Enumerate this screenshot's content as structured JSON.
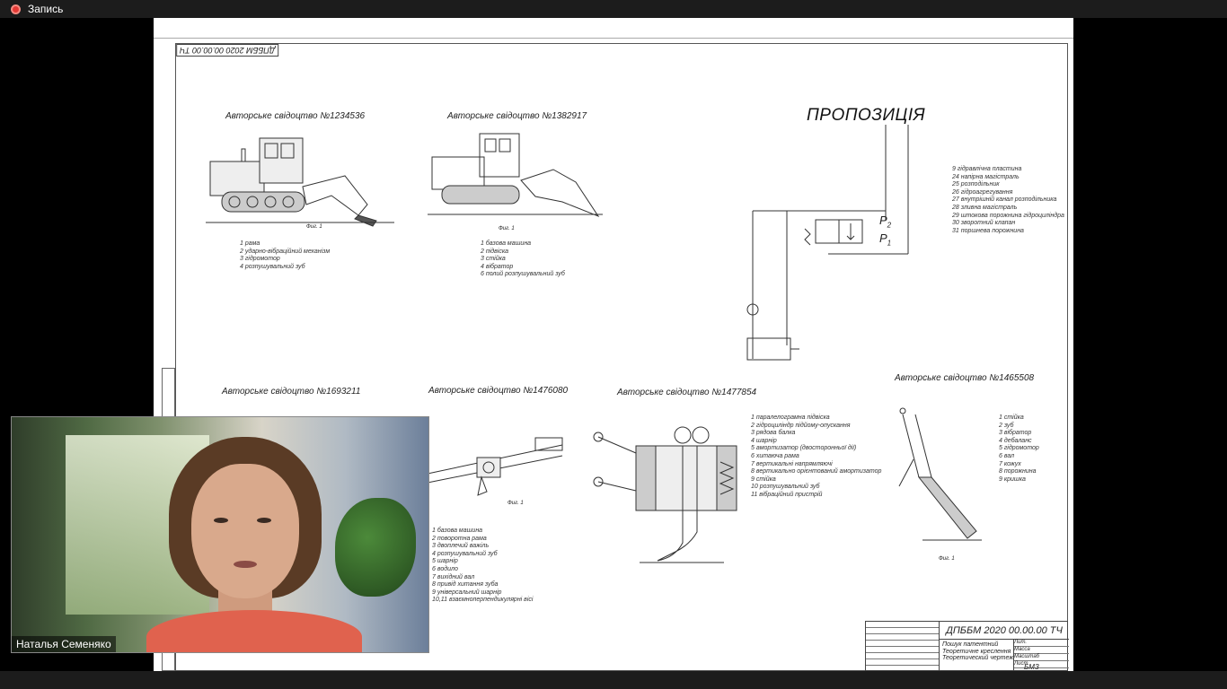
{
  "recording": {
    "label": "Запись"
  },
  "sheet": {
    "stamp": "ДПББМ 2020 00.00.00 ТЧ",
    "proposition_title": "ПРОПОЗИЦІЯ",
    "p2": "P",
    "p2_sub": "2",
    "p1": "P",
    "p1_sub": "1",
    "patents": [
      {
        "caption": "Авторське свідоцтво №1234536",
        "fig": "Фиг. 1",
        "legend": [
          "1 рама",
          "2 ударно-вібраційний механізм",
          "3 гідромотор",
          "4 розпушувальний зуб"
        ]
      },
      {
        "caption": "Авторське свідоцтво №1382917",
        "fig": "Фиг. 1",
        "legend": [
          "1 базова машина",
          "2 підвіска",
          "3 стійка",
          "4 вібратор",
          "6 полий розпушувальний зуб"
        ]
      },
      {
        "caption": "Авторське свідоцтво №1693211"
      },
      {
        "caption": "Авторське свідоцтво №1476080",
        "fig": "Фиг. 1",
        "legend": [
          "1 базова машина",
          "2 поворотна рама",
          "3 двоплечий важіль",
          "4 розпушувальний зуб",
          "5 шарнір",
          "6 водило",
          "7 вихідний вал",
          "8 привід хитання зуба",
          "9 універсальний шарнір",
          "10,11 взаємноперпендикулярні вісі"
        ]
      },
      {
        "caption": "Авторське свідоцтво №1477854",
        "legend": [
          "1 паралелограмна підвіска",
          "2 гідроциліндр підйому-опускання",
          "3 рядова балка",
          "4 шарнір",
          "5 амортизатор (двосторонньої дії)",
          "6 хитаюча рама",
          "7 вертикальні напрямляючі",
          "8 вертикально орієнтований амортизатор",
          "9 стійка",
          "10 розпушувальний зуб",
          "11 вібраційний пристрій"
        ]
      },
      {
        "caption": "Авторське свідоцтво №1465508",
        "fig": "Фиг. 1",
        "legend": [
          "1 стійка",
          "2 зуб",
          "3 вібратор",
          "4 дебаланс",
          "5 гідромотор",
          "6 вал",
          "7 кожух",
          "8 порожнина",
          "9 кришка"
        ]
      }
    ],
    "proposition_legend": [
      "9 гідравлічна пластина",
      "24 напірна магістраль",
      "25 розподільник",
      "26 гідроагрегування",
      "27 внутрішній канал розподільника",
      "28 зливна магістраль",
      "29 штокова порожнина гідроциліндра",
      "30 зворотний клапан",
      "31 поршнева порожнина"
    ],
    "titleblock": {
      "doc": "ДПББМ 2020 00.00.00 ТЧ",
      "name": [
        "Пошук патентний",
        "Теоретичне креслення",
        "Теоретический чертеж"
      ],
      "org": "БМЗ",
      "cells": [
        "Лит.",
        "Масса",
        "Масштаб",
        "Лист",
        "Листов"
      ]
    }
  },
  "video": {
    "participant_name": "Наталья Семеняко"
  }
}
